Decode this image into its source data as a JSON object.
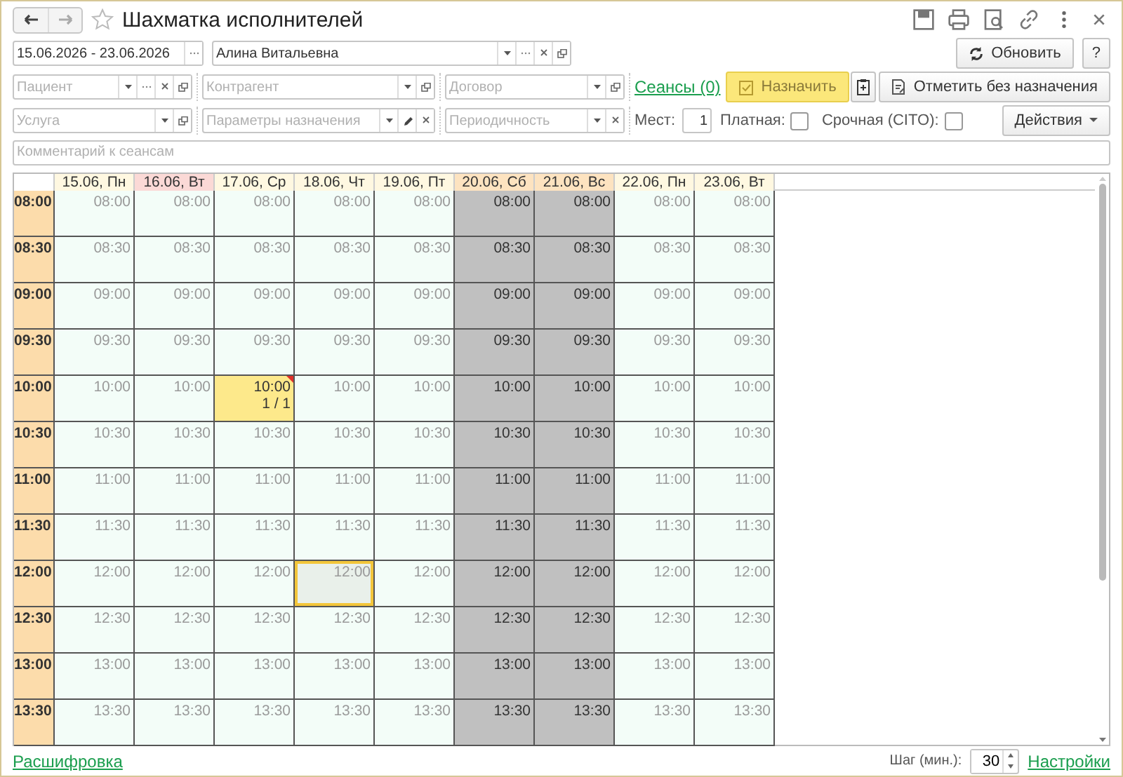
{
  "window": {
    "title": "Шахматка исполнителей"
  },
  "period": {
    "value": "15.06.2026 - 23.06.2026"
  },
  "performer": {
    "value": "Алина Витальевна"
  },
  "refresh_button": "Обновить",
  "help_button": "?",
  "filters_row1": [
    {
      "placeholder": "Пациент"
    },
    {
      "placeholder": "Контрагент"
    },
    {
      "placeholder": "Договор"
    }
  ],
  "sessions_link": "Сеансы (0)",
  "assign_button": "Назначить",
  "mark_button": "Отметить без назначения",
  "filters_row2": [
    {
      "placeholder": "Услуга"
    },
    {
      "placeholder": "Параметры назначения"
    },
    {
      "placeholder": "Периодичность"
    }
  ],
  "places": {
    "label": "Мест:",
    "value": "1"
  },
  "options": [
    {
      "label": "Платная:",
      "checked": false
    },
    {
      "label": "Срочная (CITO):",
      "checked": false
    }
  ],
  "actions_button": "Действия",
  "comment": {
    "placeholder": "Комментарий к сеансам"
  },
  "days": [
    {
      "label": "15.06, Пн",
      "kind": "workday"
    },
    {
      "label": "16.06, Вт",
      "kind": "today"
    },
    {
      "label": "17.06, Ср",
      "kind": "workday"
    },
    {
      "label": "18.06, Чт",
      "kind": "workday"
    },
    {
      "label": "19.06, Пт",
      "kind": "workday"
    },
    {
      "label": "20.06, Сб",
      "kind": "weekend"
    },
    {
      "label": "21.06, Вс",
      "kind": "weekend"
    },
    {
      "label": "22.06, Пн",
      "kind": "workday"
    },
    {
      "label": "23.06, Вт",
      "kind": "workday"
    }
  ],
  "rows": [
    {
      "time": "08:00",
      "cells": [
        {
          "text": "08:00",
          "kind": "free",
          "selected": false
        },
        {
          "text": "08:00",
          "kind": "free",
          "selected": false
        },
        {
          "text": "08:00",
          "kind": "free",
          "selected": false
        },
        {
          "text": "08:00",
          "kind": "free",
          "selected": false
        },
        {
          "text": "08:00",
          "kind": "free",
          "selected": false
        },
        {
          "text": "08:00",
          "kind": "dayoff",
          "selected": false
        },
        {
          "text": "08:00",
          "kind": "dayoff",
          "selected": false
        },
        {
          "text": "08:00",
          "kind": "free",
          "selected": false
        },
        {
          "text": "08:00",
          "kind": "free",
          "selected": false
        }
      ]
    },
    {
      "time": "08:30",
      "cells": [
        {
          "text": "08:30",
          "kind": "free",
          "selected": false
        },
        {
          "text": "08:30",
          "kind": "free",
          "selected": false
        },
        {
          "text": "08:30",
          "kind": "free",
          "selected": false
        },
        {
          "text": "08:30",
          "kind": "free",
          "selected": false
        },
        {
          "text": "08:30",
          "kind": "free",
          "selected": false
        },
        {
          "text": "08:30",
          "kind": "dayoff",
          "selected": false
        },
        {
          "text": "08:30",
          "kind": "dayoff",
          "selected": false
        },
        {
          "text": "08:30",
          "kind": "free",
          "selected": false
        },
        {
          "text": "08:30",
          "kind": "free",
          "selected": false
        }
      ]
    },
    {
      "time": "09:00",
      "cells": [
        {
          "text": "09:00",
          "kind": "free",
          "selected": false
        },
        {
          "text": "09:00",
          "kind": "free",
          "selected": false
        },
        {
          "text": "09:00",
          "kind": "free",
          "selected": false
        },
        {
          "text": "09:00",
          "kind": "free",
          "selected": false
        },
        {
          "text": "09:00",
          "kind": "free",
          "selected": false
        },
        {
          "text": "09:00",
          "kind": "dayoff",
          "selected": false
        },
        {
          "text": "09:00",
          "kind": "dayoff",
          "selected": false
        },
        {
          "text": "09:00",
          "kind": "free",
          "selected": false
        },
        {
          "text": "09:00",
          "kind": "free",
          "selected": false
        }
      ]
    },
    {
      "time": "09:30",
      "cells": [
        {
          "text": "09:30",
          "kind": "free",
          "selected": false
        },
        {
          "text": "09:30",
          "kind": "free",
          "selected": false
        },
        {
          "text": "09:30",
          "kind": "free",
          "selected": false
        },
        {
          "text": "09:30",
          "kind": "free",
          "selected": false
        },
        {
          "text": "09:30",
          "kind": "free",
          "selected": false
        },
        {
          "text": "09:30",
          "kind": "dayoff",
          "selected": false
        },
        {
          "text": "09:30",
          "kind": "dayoff",
          "selected": false
        },
        {
          "text": "09:30",
          "kind": "free",
          "selected": false
        },
        {
          "text": "09:30",
          "kind": "free",
          "selected": false
        }
      ]
    },
    {
      "time": "10:00",
      "cells": [
        {
          "text": "10:00",
          "kind": "free",
          "selected": false
        },
        {
          "text": "10:00",
          "kind": "free",
          "selected": false
        },
        {
          "text": "10:00",
          "kind": "booked",
          "count": "1 / 1",
          "selected": false
        },
        {
          "text": "10:00",
          "kind": "free",
          "selected": false
        },
        {
          "text": "10:00",
          "kind": "free",
          "selected": false
        },
        {
          "text": "10:00",
          "kind": "dayoff",
          "selected": false
        },
        {
          "text": "10:00",
          "kind": "dayoff",
          "selected": false
        },
        {
          "text": "10:00",
          "kind": "free",
          "selected": false
        },
        {
          "text": "10:00",
          "kind": "free",
          "selected": false
        }
      ]
    },
    {
      "time": "10:30",
      "cells": [
        {
          "text": "10:30",
          "kind": "free",
          "selected": false
        },
        {
          "text": "10:30",
          "kind": "free",
          "selected": false
        },
        {
          "text": "10:30",
          "kind": "free",
          "selected": false
        },
        {
          "text": "10:30",
          "kind": "free",
          "selected": false
        },
        {
          "text": "10:30",
          "kind": "free",
          "selected": false
        },
        {
          "text": "10:30",
          "kind": "dayoff",
          "selected": false
        },
        {
          "text": "10:30",
          "kind": "dayoff",
          "selected": false
        },
        {
          "text": "10:30",
          "kind": "free",
          "selected": false
        },
        {
          "text": "10:30",
          "kind": "free",
          "selected": false
        }
      ]
    },
    {
      "time": "11:00",
      "cells": [
        {
          "text": "11:00",
          "kind": "free",
          "selected": false
        },
        {
          "text": "11:00",
          "kind": "free",
          "selected": false
        },
        {
          "text": "11:00",
          "kind": "free",
          "selected": false
        },
        {
          "text": "11:00",
          "kind": "free",
          "selected": false
        },
        {
          "text": "11:00",
          "kind": "free",
          "selected": false
        },
        {
          "text": "11:00",
          "kind": "dayoff",
          "selected": false
        },
        {
          "text": "11:00",
          "kind": "dayoff",
          "selected": false
        },
        {
          "text": "11:00",
          "kind": "free",
          "selected": false
        },
        {
          "text": "11:00",
          "kind": "free",
          "selected": false
        }
      ]
    },
    {
      "time": "11:30",
      "cells": [
        {
          "text": "11:30",
          "kind": "free",
          "selected": false
        },
        {
          "text": "11:30",
          "kind": "free",
          "selected": false
        },
        {
          "text": "11:30",
          "kind": "free",
          "selected": false
        },
        {
          "text": "11:30",
          "kind": "free",
          "selected": false
        },
        {
          "text": "11:30",
          "kind": "free",
          "selected": false
        },
        {
          "text": "11:30",
          "kind": "dayoff",
          "selected": false
        },
        {
          "text": "11:30",
          "kind": "dayoff",
          "selected": false
        },
        {
          "text": "11:30",
          "kind": "free",
          "selected": false
        },
        {
          "text": "11:30",
          "kind": "free",
          "selected": false
        }
      ]
    },
    {
      "time": "12:00",
      "cells": [
        {
          "text": "12:00",
          "kind": "free",
          "selected": false
        },
        {
          "text": "12:00",
          "kind": "free",
          "selected": false
        },
        {
          "text": "12:00",
          "kind": "free",
          "selected": false
        },
        {
          "text": "12:00",
          "kind": "free",
          "selected": true
        },
        {
          "text": "12:00",
          "kind": "free",
          "selected": false
        },
        {
          "text": "12:00",
          "kind": "dayoff",
          "selected": false
        },
        {
          "text": "12:00",
          "kind": "dayoff",
          "selected": false
        },
        {
          "text": "12:00",
          "kind": "free",
          "selected": false
        },
        {
          "text": "12:00",
          "kind": "free",
          "selected": false
        }
      ]
    },
    {
      "time": "12:30",
      "cells": [
        {
          "text": "12:30",
          "kind": "free",
          "selected": false
        },
        {
          "text": "12:30",
          "kind": "free",
          "selected": false
        },
        {
          "text": "12:30",
          "kind": "free",
          "selected": false
        },
        {
          "text": "12:30",
          "kind": "free",
          "selected": false
        },
        {
          "text": "12:30",
          "kind": "free",
          "selected": false
        },
        {
          "text": "12:30",
          "kind": "dayoff",
          "selected": false
        },
        {
          "text": "12:30",
          "kind": "dayoff",
          "selected": false
        },
        {
          "text": "12:30",
          "kind": "free",
          "selected": false
        },
        {
          "text": "12:30",
          "kind": "free",
          "selected": false
        }
      ]
    },
    {
      "time": "13:00",
      "cells": [
        {
          "text": "13:00",
          "kind": "free",
          "selected": false
        },
        {
          "text": "13:00",
          "kind": "free",
          "selected": false
        },
        {
          "text": "13:00",
          "kind": "free",
          "selected": false
        },
        {
          "text": "13:00",
          "kind": "free",
          "selected": false
        },
        {
          "text": "13:00",
          "kind": "free",
          "selected": false
        },
        {
          "text": "13:00",
          "kind": "dayoff",
          "selected": false
        },
        {
          "text": "13:00",
          "kind": "dayoff",
          "selected": false
        },
        {
          "text": "13:00",
          "kind": "free",
          "selected": false
        },
        {
          "text": "13:00",
          "kind": "free",
          "selected": false
        }
      ]
    },
    {
      "time": "13:30",
      "cells": [
        {
          "text": "13:30",
          "kind": "free",
          "selected": false
        },
        {
          "text": "13:30",
          "kind": "free",
          "selected": false
        },
        {
          "text": "13:30",
          "kind": "free",
          "selected": false
        },
        {
          "text": "13:30",
          "kind": "free",
          "selected": false
        },
        {
          "text": "13:30",
          "kind": "free",
          "selected": false
        },
        {
          "text": "13:30",
          "kind": "dayoff",
          "selected": false
        },
        {
          "text": "13:30",
          "kind": "dayoff",
          "selected": false
        },
        {
          "text": "13:30",
          "kind": "free",
          "selected": false
        },
        {
          "text": "13:30",
          "kind": "free",
          "selected": false
        }
      ]
    }
  ],
  "footer": {
    "link": "Расшифровка",
    "step_label": "Шаг (мин.):",
    "step_value": "30",
    "settings_link": "Настройки"
  }
}
